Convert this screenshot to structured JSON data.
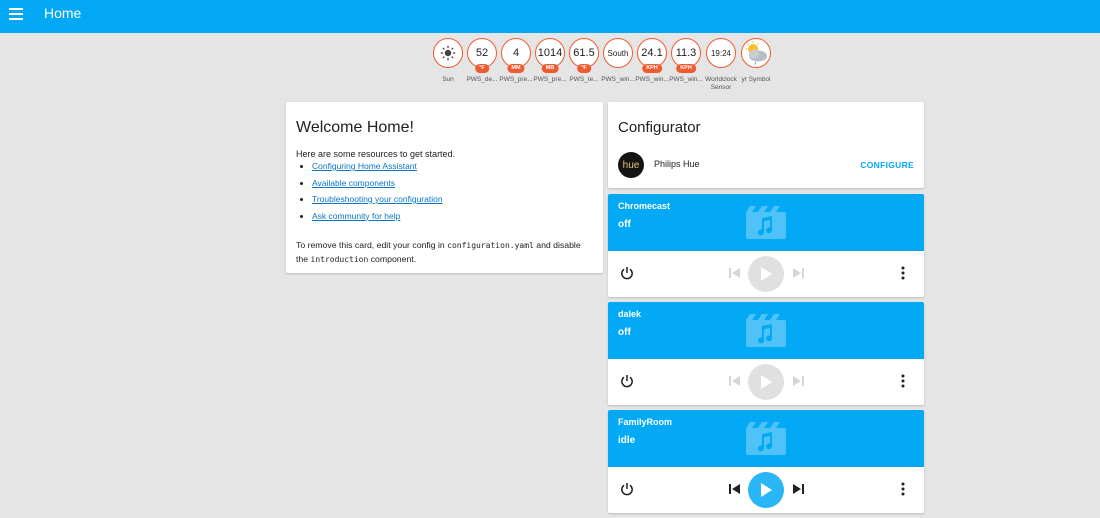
{
  "header": {
    "title": "Home",
    "menu_icon": "menu-icon"
  },
  "badges": [
    {
      "value": "",
      "icon": "sun-icon",
      "unit": "",
      "label": "Sun"
    },
    {
      "value": "52",
      "unit": "°F",
      "label": "PWS_de..."
    },
    {
      "value": "4",
      "unit": "MM",
      "label": "PWS_pre..."
    },
    {
      "value": "1014",
      "unit": "MB",
      "label": "PWS_pre..."
    },
    {
      "value": "61.5",
      "unit": "°F",
      "label": "PWS_te..."
    },
    {
      "value": "South",
      "unit": "",
      "label": "PWS_win..."
    },
    {
      "value": "24.1",
      "unit": "KPH",
      "label": "PWS_win..."
    },
    {
      "value": "11.3",
      "unit": "KPH",
      "label": "PWS_win..."
    },
    {
      "value": "19:24",
      "unit": "",
      "label": "Worldclock Sensor"
    },
    {
      "value": "",
      "icon": "weather-partly-cloudy-icon",
      "unit": "",
      "label": "yr Symbol"
    }
  ],
  "welcome": {
    "title": "Welcome Home!",
    "intro": "Here are some resources to get started.",
    "links": [
      "Configuring Home Assistant",
      "Available components",
      "Troubleshooting your configuration",
      "Ask community for help"
    ],
    "removal_1": "To remove this card, edit your config in ",
    "removal_code1": "configuration.yaml",
    "removal_2": " and disable the ",
    "removal_code2": "introduction",
    "removal_3": " component."
  },
  "configurator": {
    "title": "Configurator",
    "item_logo": "hue",
    "item_name": "Philips Hue",
    "action": "CONFIGURE"
  },
  "media_players": [
    {
      "name": "Chromecast",
      "state": "off",
      "active": false
    },
    {
      "name": "dalek",
      "state": "off",
      "active": false
    },
    {
      "name": "FamilyRoom",
      "state": "idle",
      "active": true
    }
  ],
  "colors": {
    "accent": "#03a9f4",
    "badge_border": "#ef5b30",
    "background": "#e5e5e5"
  }
}
